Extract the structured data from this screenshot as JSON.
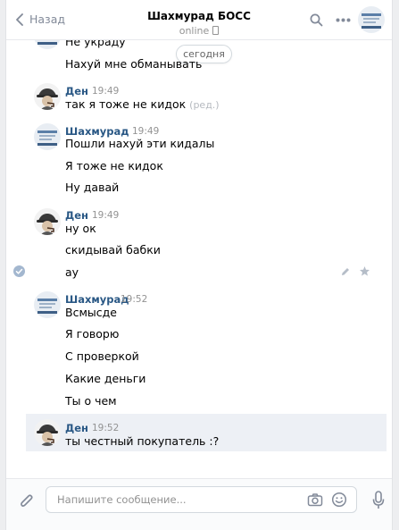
{
  "header": {
    "back_label": "Назад",
    "title": "Шахмурад БОСС",
    "status": "online"
  },
  "chat": {
    "date_label": "сегодня",
    "partial_top": "Не украду",
    "messages": [
      {
        "text": "Нахуй мне обманывать"
      },
      {
        "author": "Ден",
        "time": "19:49",
        "text": "так я тоже не кидок",
        "edited": "(ред.)"
      },
      {
        "author": "Шахмурад",
        "time": "19:49",
        "text": "Пошли нахуй эти кидалы"
      },
      {
        "text": "Я тоже не кидок"
      },
      {
        "text": "Ну давай"
      },
      {
        "author": "Ден",
        "time": "19:49",
        "text": "ну ок"
      },
      {
        "text": "скидывай бабки"
      },
      {
        "text": "ау"
      },
      {
        "author": "Шахмурад",
        "time": "19:52",
        "text": "Всмысде"
      },
      {
        "text": "Я говорю"
      },
      {
        "text": "С проверкой"
      },
      {
        "text": "Какие деньги"
      },
      {
        "text": "Ты о чем"
      },
      {
        "author": "Ден",
        "time": "19:52",
        "text": "ты честный покупатель :?"
      }
    ]
  },
  "composer": {
    "placeholder": "Напишите сообщение..."
  },
  "colors": {
    "link": "#2a5885",
    "selected_bg": "#edf0f5",
    "muted": "#939393"
  }
}
